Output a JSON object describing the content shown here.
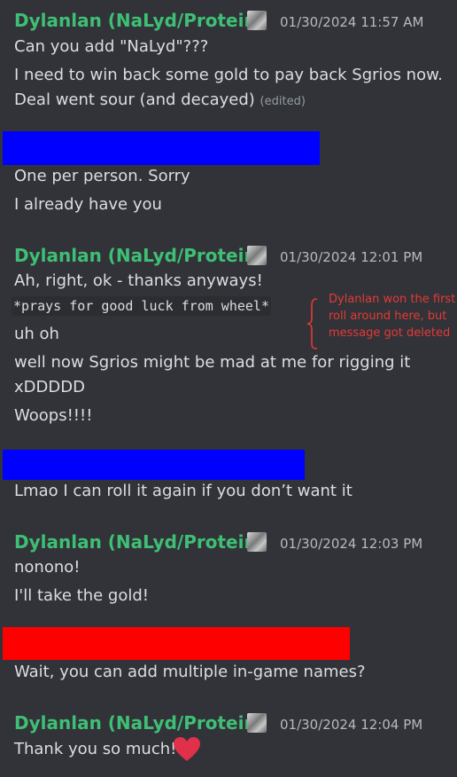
{
  "messages": [
    {
      "author": "Dylanlan (NaLyd/Protein)",
      "timestamp": "01/30/2024 11:57 AM",
      "lines": [
        "Can you add \"NaLyd\"???",
        "I need to win back some gold to pay back Sgrios now.",
        "Deal went sour (and decayed)"
      ],
      "edited": "(edited)"
    },
    {
      "lines": [
        "One per person. Sorry",
        "I already have you"
      ]
    },
    {
      "author": "Dylanlan (NaLyd/Protein)",
      "timestamp": "01/30/2024 12:01 PM",
      "lines": [
        "Ah, right, ok - thanks anyways!",
        "*prays for good luck from wheel*",
        "uh oh",
        "well now Sgrios might be mad at me for rigging it",
        "xDDDDD",
        "Woops!!!!"
      ]
    },
    {
      "lines": [
        "Lmao I can roll it again if you don’t want it"
      ]
    },
    {
      "author": "Dylanlan (NaLyd/Protein)",
      "timestamp": "01/30/2024 12:03 PM",
      "lines": [
        "nonono!",
        "I'll take the gold!"
      ]
    },
    {
      "lines": [
        "Wait, you can add multiple in-game names?"
      ]
    },
    {
      "author": "Dylanlan (NaLyd/Protein)",
      "timestamp": "01/30/2024 12:04 PM",
      "lines": [
        "Thank you so much!!!"
      ]
    }
  ],
  "annotation": {
    "lines": [
      "Dylanlan won the first",
      "roll around here, but",
      "message got deleted"
    ],
    "color": "#e53935"
  },
  "colors": {
    "background": "#313338",
    "username": "#3fbf75",
    "redact_blue": "#0000ff",
    "redact_red": "#ff0000",
    "heart": "#e0304a"
  },
  "icons": [
    "avatar-badge-icon",
    "heart-emoji-icon",
    "curly-brace-icon"
  ]
}
